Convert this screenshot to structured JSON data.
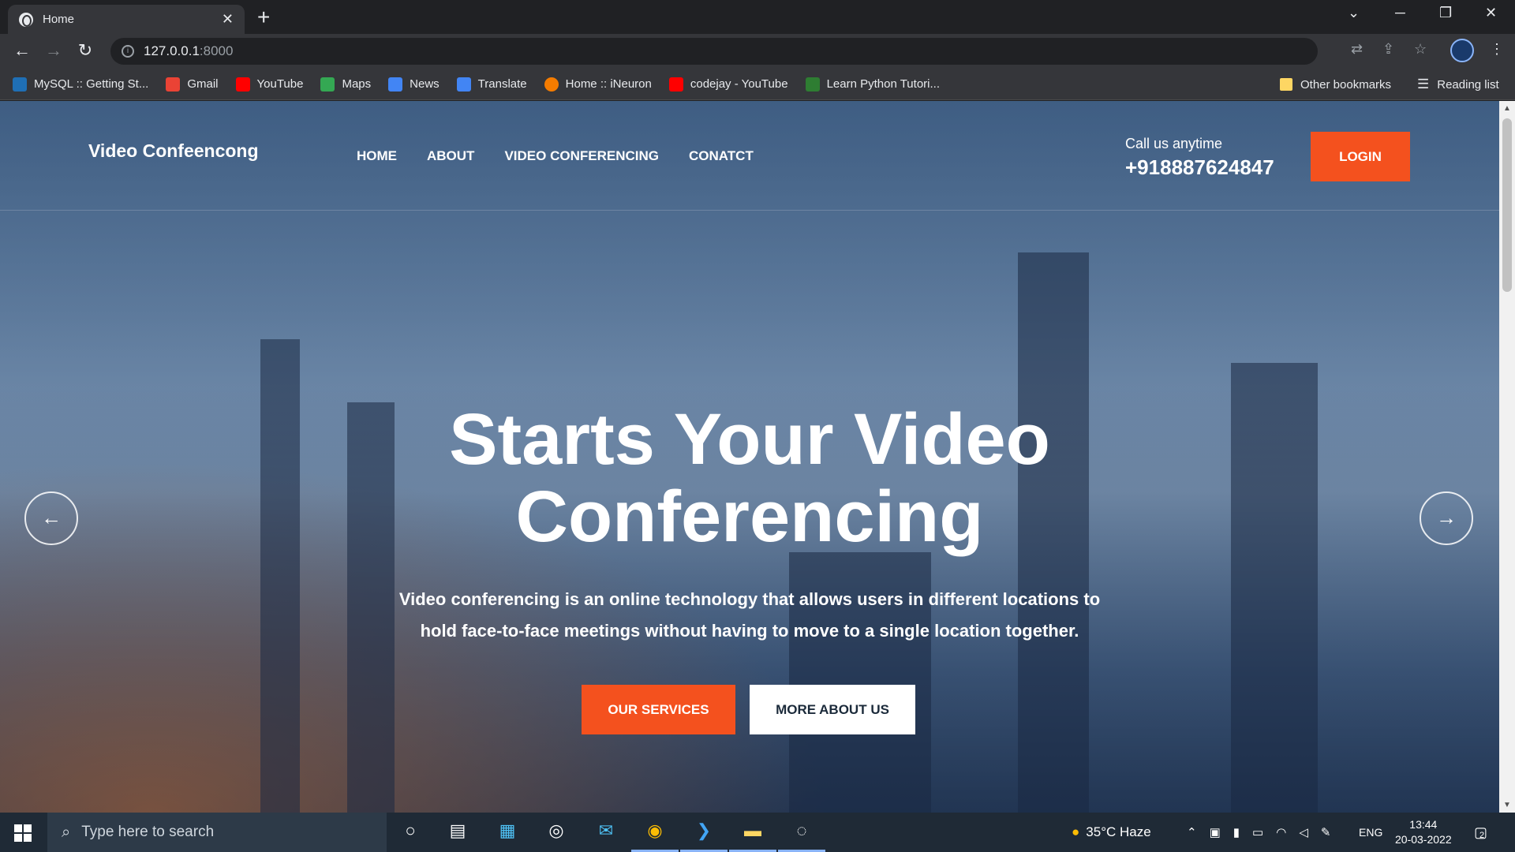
{
  "browser": {
    "tab_title": "Home",
    "url_host": "127.0.0.1",
    "url_port": ":8000",
    "bookmarks": [
      {
        "label": "MySQL :: Getting St...",
        "color": "#1f6fb5"
      },
      {
        "label": "Gmail",
        "color": "#ea4335"
      },
      {
        "label": "YouTube",
        "color": "#ff0000"
      },
      {
        "label": "Maps",
        "color": "#34a853"
      },
      {
        "label": "News",
        "color": "#4285f4"
      },
      {
        "label": "Translate",
        "color": "#4285f4"
      },
      {
        "label": "Home :: iNeuron",
        "color": "#f57c00"
      },
      {
        "label": "codejay - YouTube",
        "color": "#ff0000"
      },
      {
        "label": "Learn Python Tutori...",
        "color": "#2e7d32"
      }
    ],
    "other_bookmarks": "Other bookmarks",
    "reading_list": "Reading list"
  },
  "site": {
    "logo": "Video Confeencong",
    "nav": [
      "HOME",
      "ABOUT",
      "VIDEO CONFERENCING",
      "CONATCT"
    ],
    "call_label": "Call us anytime",
    "call_number": "+918887624847",
    "login": "LOGIN",
    "hero_line1": "Starts Your Video",
    "hero_line2": "Conferencing",
    "hero_text": "Video conferencing is an online technology that allows users in different locations to hold face-to-face meetings without having to move to a single location together.",
    "btn_services": "OUR SERVICES",
    "btn_about": "MORE ABOUT US",
    "accent": "#f4511e"
  },
  "taskbar": {
    "search_placeholder": "Type here to search",
    "weather": "35°C  Haze",
    "lang": "ENG",
    "time": "13:44",
    "date": "20-03-2022",
    "notifications": "2"
  }
}
